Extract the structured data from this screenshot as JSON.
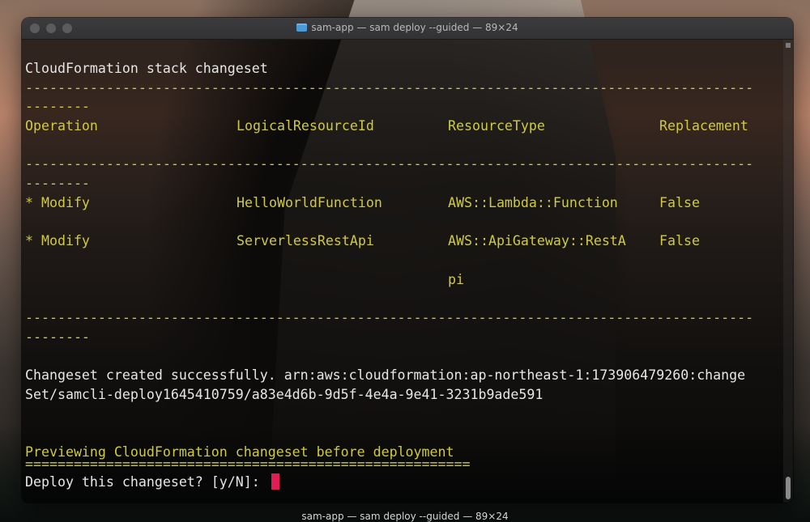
{
  "window": {
    "title": "sam-app — sam deploy --guided — 89×24"
  },
  "terminal": {
    "heading": "CloudFormation stack changeset",
    "dash_line": "------------------------------------------------------------------------------------------",
    "dash_tail": "--------",
    "columns": [
      "Operation",
      "LogicalResourceId",
      "ResourceType",
      "Replacement"
    ],
    "rows": [
      {
        "op": "* Modify",
        "id": "HelloWorldFunction",
        "type": "AWS::Lambda::Function",
        "replace": "False"
      },
      {
        "op": "* Modify",
        "id": "ServerlessRestApi",
        "type": "AWS::ApiGateway::RestA",
        "replace": "False"
      }
    ],
    "row_wrap": "pi",
    "success_line1": "Changeset created successfully. arn:aws:cloudformation:ap-northeast-1:173906479260:change",
    "success_line2": "Set/samcli-deploy1645410759/a83e4d6b-9d5f-4e4a-9e41-3231b9ade591",
    "preview": "Previewing CloudFormation changeset before deployment",
    "equals_line": "=======================================================",
    "prompt": "Deploy this changeset? [y/N]: "
  },
  "dock_label": "sam-app — sam deploy --guided — 89×24",
  "colors": {
    "yellow_text": "#cfca3f",
    "white_text": "#e6e6e6",
    "cursor": "#e11d58"
  }
}
